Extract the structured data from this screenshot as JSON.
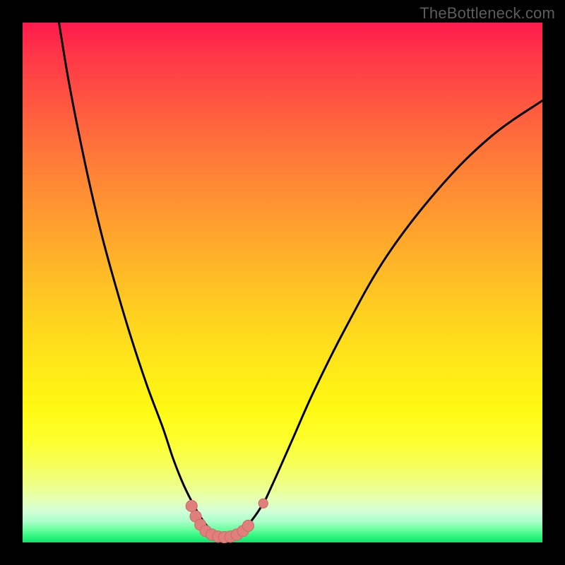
{
  "watermark": "TheBottleneck.com",
  "colors": {
    "frame": "#000000",
    "curve_stroke": "#000000",
    "marker_fill": "#e07f7b",
    "marker_stroke": "#c96a66"
  },
  "chart_data": {
    "type": "line",
    "title": "",
    "xlabel": "",
    "ylabel": "",
    "xlim": [
      0,
      100
    ],
    "ylim": [
      0,
      100
    ],
    "grid": false,
    "legend": false,
    "series": [
      {
        "name": "curve",
        "x": [
          7,
          9,
          12,
          15,
          18,
          21,
          24,
          27,
          29,
          31,
          33,
          34.5,
          36,
          37.5,
          39,
          40.5,
          43,
          46,
          48,
          52,
          56,
          62,
          70,
          80,
          90,
          100
        ],
        "y": [
          100,
          88,
          73,
          60,
          49,
          39,
          30,
          22,
          16,
          11,
          7,
          4.5,
          2.6,
          1.5,
          1.1,
          1.4,
          3,
          7,
          11,
          20,
          29,
          41,
          55,
          68,
          78,
          85
        ]
      }
    ],
    "markers": [
      {
        "x": 32.5,
        "y": 7.0,
        "r": 1.1
      },
      {
        "x": 33.3,
        "y": 5.0,
        "r": 1.1
      },
      {
        "x": 34.2,
        "y": 3.4,
        "r": 1.1
      },
      {
        "x": 35.2,
        "y": 2.2,
        "r": 1.1
      },
      {
        "x": 36.4,
        "y": 1.5,
        "r": 1.1
      },
      {
        "x": 37.6,
        "y": 1.1,
        "r": 1.1
      },
      {
        "x": 38.8,
        "y": 1.0,
        "r": 1.1
      },
      {
        "x": 40.0,
        "y": 1.1,
        "r": 1.1
      },
      {
        "x": 41.2,
        "y": 1.5,
        "r": 1.1
      },
      {
        "x": 42.4,
        "y": 2.2,
        "r": 1.1
      },
      {
        "x": 43.4,
        "y": 3.2,
        "r": 1.1
      },
      {
        "x": 46.3,
        "y": 7.5,
        "r": 0.9
      }
    ]
  }
}
